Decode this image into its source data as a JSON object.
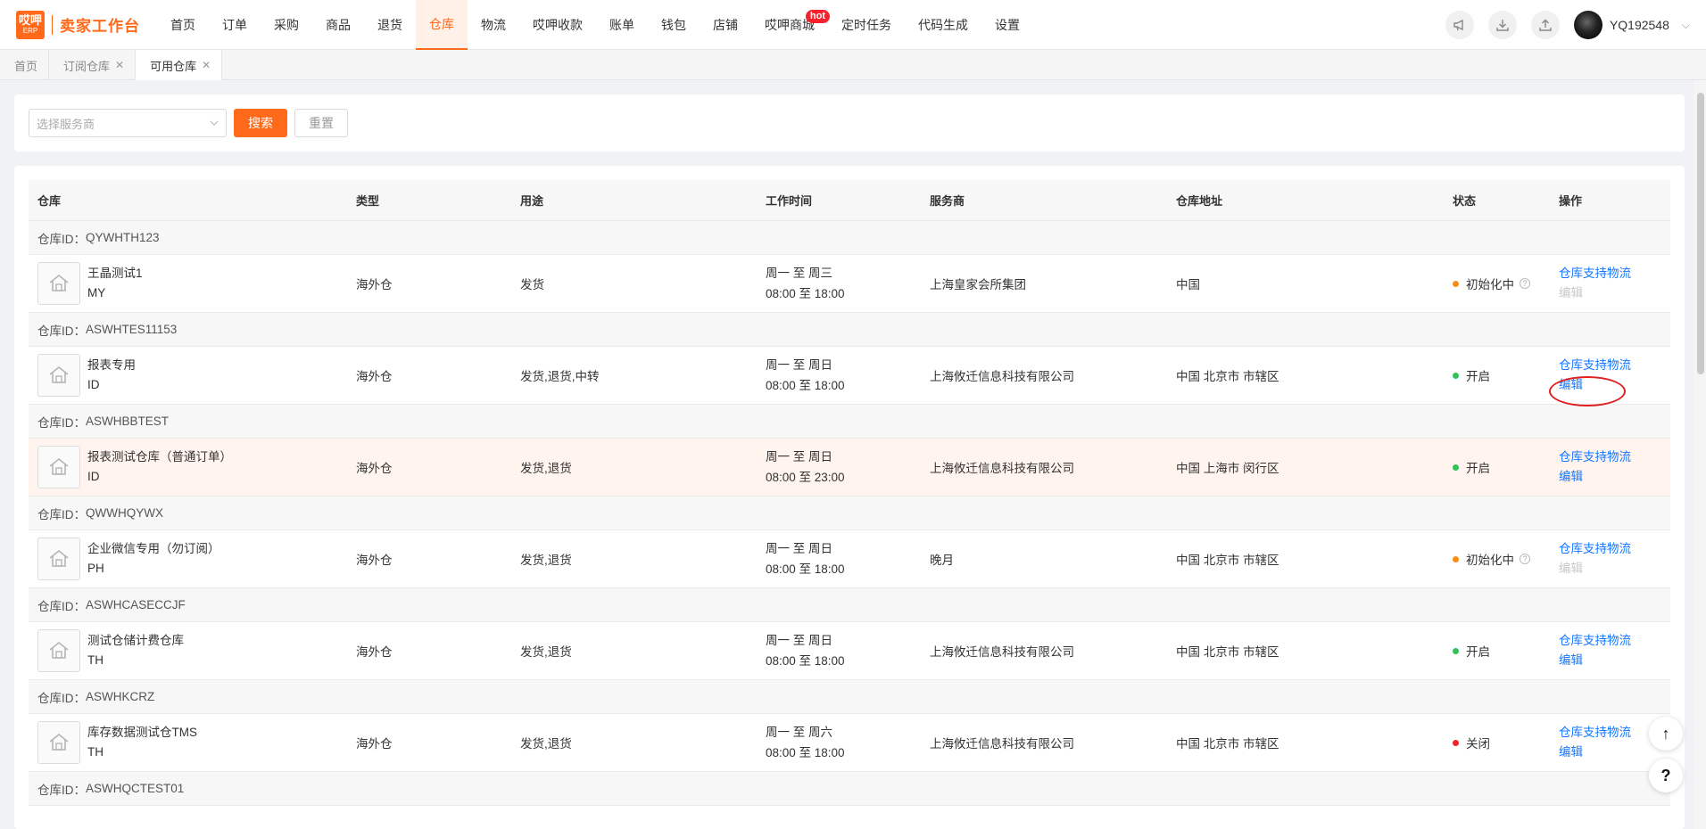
{
  "brand": {
    "logo_top": "哎呷",
    "logo_bottom": "ERP",
    "name": "卖家工作台"
  },
  "menu": [
    {
      "label": "首页"
    },
    {
      "label": "订单"
    },
    {
      "label": "采购"
    },
    {
      "label": "商品"
    },
    {
      "label": "退货"
    },
    {
      "label": "仓库",
      "active": true
    },
    {
      "label": "物流"
    },
    {
      "label": "哎呷收款"
    },
    {
      "label": "账单"
    },
    {
      "label": "钱包"
    },
    {
      "label": "店铺"
    },
    {
      "label": "哎呷商城",
      "badge": "hot"
    },
    {
      "label": "定时任务"
    },
    {
      "label": "代码生成"
    },
    {
      "label": "设置"
    }
  ],
  "user": {
    "name": "YQ192548"
  },
  "tabs": [
    {
      "label": "首页",
      "closable": false
    },
    {
      "label": "订阅仓库",
      "closable": true
    },
    {
      "label": "可用仓库",
      "closable": true,
      "active": true
    }
  ],
  "filter": {
    "select_placeholder": "选择服务商",
    "search_label": "搜索",
    "reset_label": "重置"
  },
  "table": {
    "headers": [
      "仓库",
      "类型",
      "用途",
      "工作时间",
      "服务商",
      "仓库地址",
      "状态",
      "操作"
    ],
    "id_prefix": "仓库ID：",
    "op_support": "仓库支持物流",
    "op_edit": "编辑",
    "rows": [
      {
        "id": "QYWHTH123",
        "name": "王晶测试1",
        "code": "MY",
        "type": "海外仓",
        "usage": "发货",
        "days": "周一 至 周三",
        "hours": "08:00 至 18:00",
        "provider": "上海皇家会所集团",
        "address": "中国",
        "status": "初始化中",
        "status_color": "#fa8c16",
        "help": true,
        "edit_disabled": true,
        "highlight": false
      },
      {
        "id": "ASWHTES11153",
        "name": "报表专用",
        "code": "ID",
        "type": "海外仓",
        "usage": "发货,退货,中转",
        "days": "周一 至 周日",
        "hours": "08:00 至 18:00",
        "provider": "上海攸迁信息科技有限公司",
        "address": "中国 北京市 市辖区",
        "status": "开启",
        "status_color": "#2fc25b",
        "help": false,
        "edit_disabled": false,
        "highlight": false
      },
      {
        "id": "ASWHBBTEST",
        "name": "报表测试仓库（普通订单）",
        "code": "ID",
        "type": "海外仓",
        "usage": "发货,退货",
        "days": "周一 至 周日",
        "hours": "08:00 至 23:00",
        "provider": "上海攸迁信息科技有限公司",
        "address": "中国 上海市 闵行区",
        "status": "开启",
        "status_color": "#2fc25b",
        "help": false,
        "edit_disabled": false,
        "highlight": true
      },
      {
        "id": "QWWHQYWX",
        "name": "企业微信专用（勿订阅）",
        "code": "PH",
        "type": "海外仓",
        "usage": "发货,退货",
        "days": "周一 至 周日",
        "hours": "08:00 至 18:00",
        "provider": "晚月",
        "address": "中国 北京市 市辖区",
        "status": "初始化中",
        "status_color": "#fa8c16",
        "help": true,
        "edit_disabled": true,
        "highlight": false
      },
      {
        "id": "ASWHCASECCJF",
        "name": "测试仓储计费仓库",
        "code": "TH",
        "type": "海外仓",
        "usage": "发货,退货",
        "days": "周一 至 周日",
        "hours": "08:00 至 18:00",
        "provider": "上海攸迁信息科技有限公司",
        "address": "中国 北京市 市辖区",
        "status": "开启",
        "status_color": "#2fc25b",
        "help": false,
        "edit_disabled": false,
        "highlight": false
      },
      {
        "id": "ASWHKCRZ",
        "name": "库存数据测试仓TMS",
        "code": "TH",
        "type": "海外仓",
        "usage": "发货,退货",
        "days": "周一 至 周六",
        "hours": "08:00 至 18:00",
        "provider": "上海攸迁信息科技有限公司",
        "address": "中国 北京市 市辖区",
        "status": "关闭",
        "status_color": "#f5222d",
        "help": false,
        "edit_disabled": false,
        "highlight": false
      }
    ],
    "trailing_group_id": "ASWHQCTEST01"
  },
  "float": {
    "top_label": "↑",
    "help_label": "?"
  }
}
